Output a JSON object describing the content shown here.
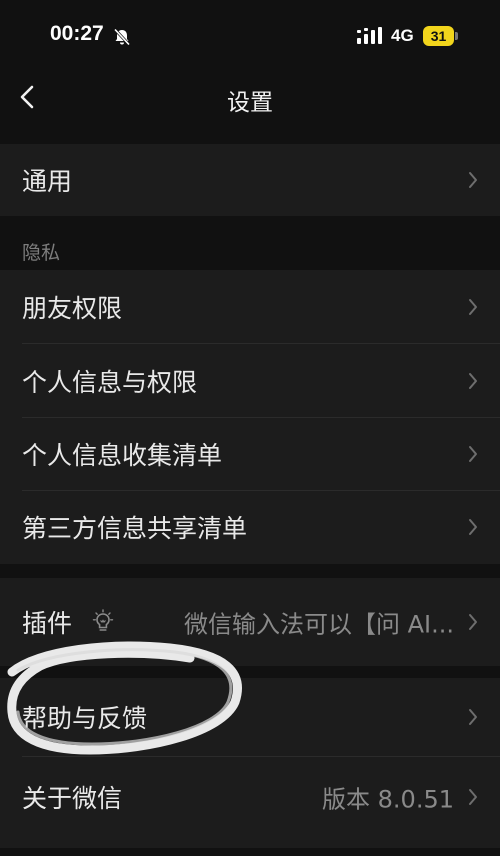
{
  "status_bar": {
    "time": "00:27",
    "network": "4G",
    "battery": "31",
    "icons": [
      "bell-slash-icon",
      "signal-icon",
      "battery-icon"
    ]
  },
  "nav": {
    "title": "设置",
    "back_icon": "chevron-left-icon"
  },
  "general": {
    "label": "通用"
  },
  "privacy": {
    "section_label": "隐私",
    "items": [
      {
        "label": "朋友权限"
      },
      {
        "label": "个人信息与权限"
      },
      {
        "label": "个人信息收集清单"
      },
      {
        "label": "第三方信息共享清单"
      }
    ]
  },
  "plugins": {
    "label": "插件",
    "icon": "lightbulb-icon",
    "value": "微信输入法可以【问 AI..."
  },
  "help": {
    "label": "帮助与反馈"
  },
  "about": {
    "label": "关于微信",
    "value": "版本 8.0.51"
  },
  "colors": {
    "background": "#111111",
    "cell": "#1c1c1c",
    "text": "#e9e9e9",
    "secondary": "#8a8a8a",
    "battery": "#f2d51c"
  }
}
